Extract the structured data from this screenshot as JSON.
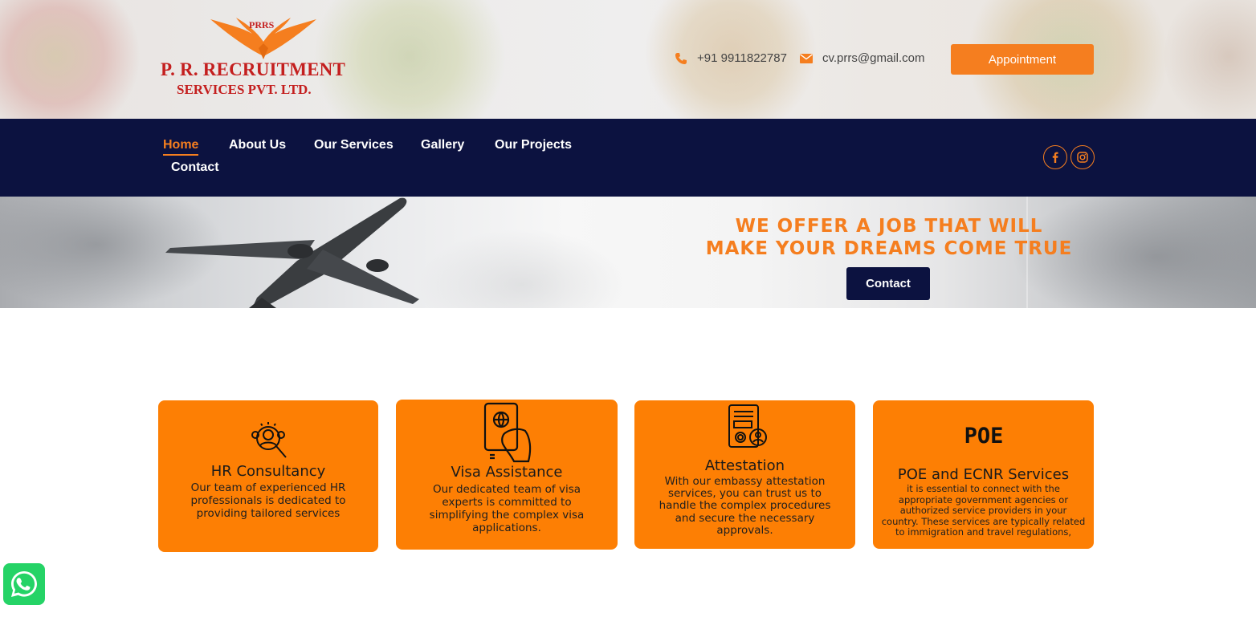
{
  "header": {
    "logo": {
      "badge": "PRRS",
      "line1": "P. R. RECRUITMENT",
      "line2": "SERVICES PVT. LTD."
    },
    "phone": "+91 9911822787",
    "email": "cv.prrs@gmail.com",
    "appointment_label": "Appointment"
  },
  "nav": {
    "items": [
      {
        "label": "Home",
        "active": true
      },
      {
        "label": "About Us"
      },
      {
        "label": "Our Services"
      },
      {
        "label": "Gallery"
      },
      {
        "label": "Our Projects"
      },
      {
        "label": "Contact"
      }
    ],
    "social": [
      "facebook-icon",
      "instagram-icon"
    ]
  },
  "hero": {
    "title_line1": "WE OFFER A JOB THAT WILL",
    "title_line2": "MAKE YOUR DREAMS COME TRUE",
    "button_label": "Contact"
  },
  "cards": [
    {
      "icon": "hr-consultancy-icon",
      "title": "HR Consultancy",
      "desc": [
        "Our team of experienced HR",
        "professionals is dedicated to",
        "providing tailored services"
      ]
    },
    {
      "icon": "visa-passport-icon",
      "title": "Visa Assistance",
      "desc": [
        "Our dedicated team of visa",
        "experts is committed to",
        "simplifying the complex visa",
        "applications."
      ]
    },
    {
      "icon": "attestation-certificate-icon",
      "title": "Attestation",
      "desc": [
        "With our embassy attestation",
        "services, you can trust us to",
        "handle the complex procedures",
        "and secure the necessary",
        "approvals."
      ]
    },
    {
      "icon": "poe-icon",
      "icon_text": "POE",
      "title": "POE and ECNR Services",
      "desc": [
        "it is essential to connect with the",
        "appropriate government agencies or",
        "authorized service providers in your",
        "country. These services are typically related",
        "to immigration and travel regulations,"
      ]
    }
  ],
  "colors": {
    "accent": "#f57e1f",
    "card": "#fd7f04",
    "navy": "#0c1240",
    "logo_red": "#c41f1f",
    "whatsapp": "#25d366"
  },
  "floating": {
    "whatsapp_icon": "whatsapp-icon"
  }
}
